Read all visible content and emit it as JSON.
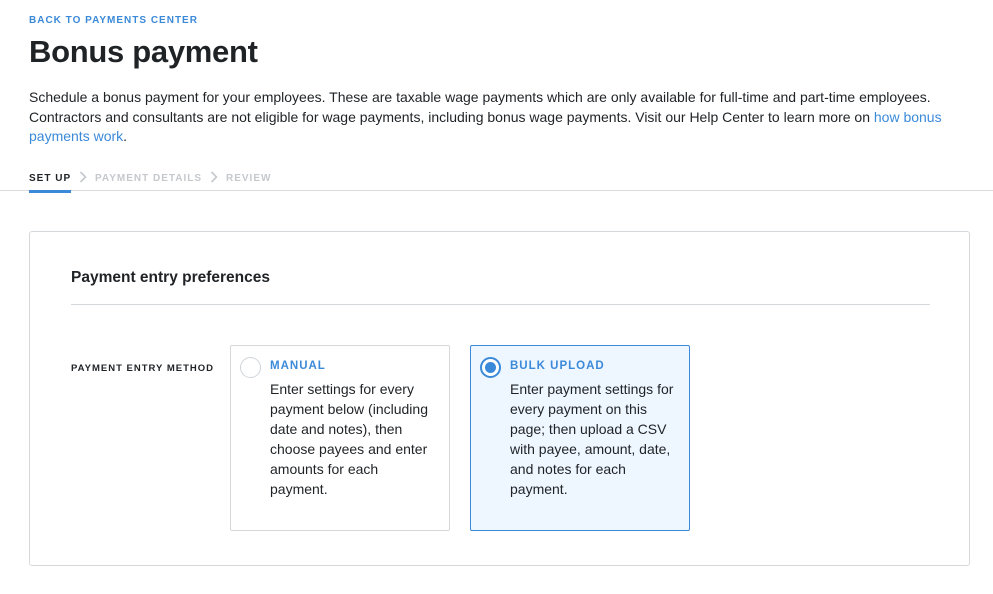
{
  "back_link": "BACK TO PAYMENTS CENTER",
  "title": "Bonus payment",
  "description": {
    "text": "Schedule a bonus payment for your employees. These are taxable wage payments which are only available for full-time and part-time employees. Contractors and consultants are not eligible for wage payments, including bonus wage payments. Visit our Help Center to learn more on ",
    "link": "how bonus payments work",
    "suffix": "."
  },
  "steps": [
    {
      "label": "SET UP",
      "state": "active"
    },
    {
      "label": "PAYMENT DETAILS",
      "state": "inactive"
    },
    {
      "label": "REVIEW",
      "state": "inactive"
    }
  ],
  "card": {
    "title": "Payment entry preferences",
    "field_label": "PAYMENT ENTRY METHOD",
    "options": [
      {
        "title": "MANUAL",
        "description": "Enter settings for every payment below (including date and notes), then choose payees and enter amounts for each payment.",
        "selected": false
      },
      {
        "title": "BULK UPLOAD",
        "description": "Enter payment settings for every payment on this page; then upload a CSV with payee, amount, date, and notes for each payment.",
        "selected": true
      }
    ]
  },
  "colors": {
    "accent": "#3b8ad9",
    "text": "#1f2326",
    "muted": "#c5c9cd",
    "selected_bg": "#eef6ff",
    "border": "#d5d9dc"
  },
  "icons": {
    "step_separator": "chevron-right-icon",
    "radio": "radio-button-icon"
  }
}
